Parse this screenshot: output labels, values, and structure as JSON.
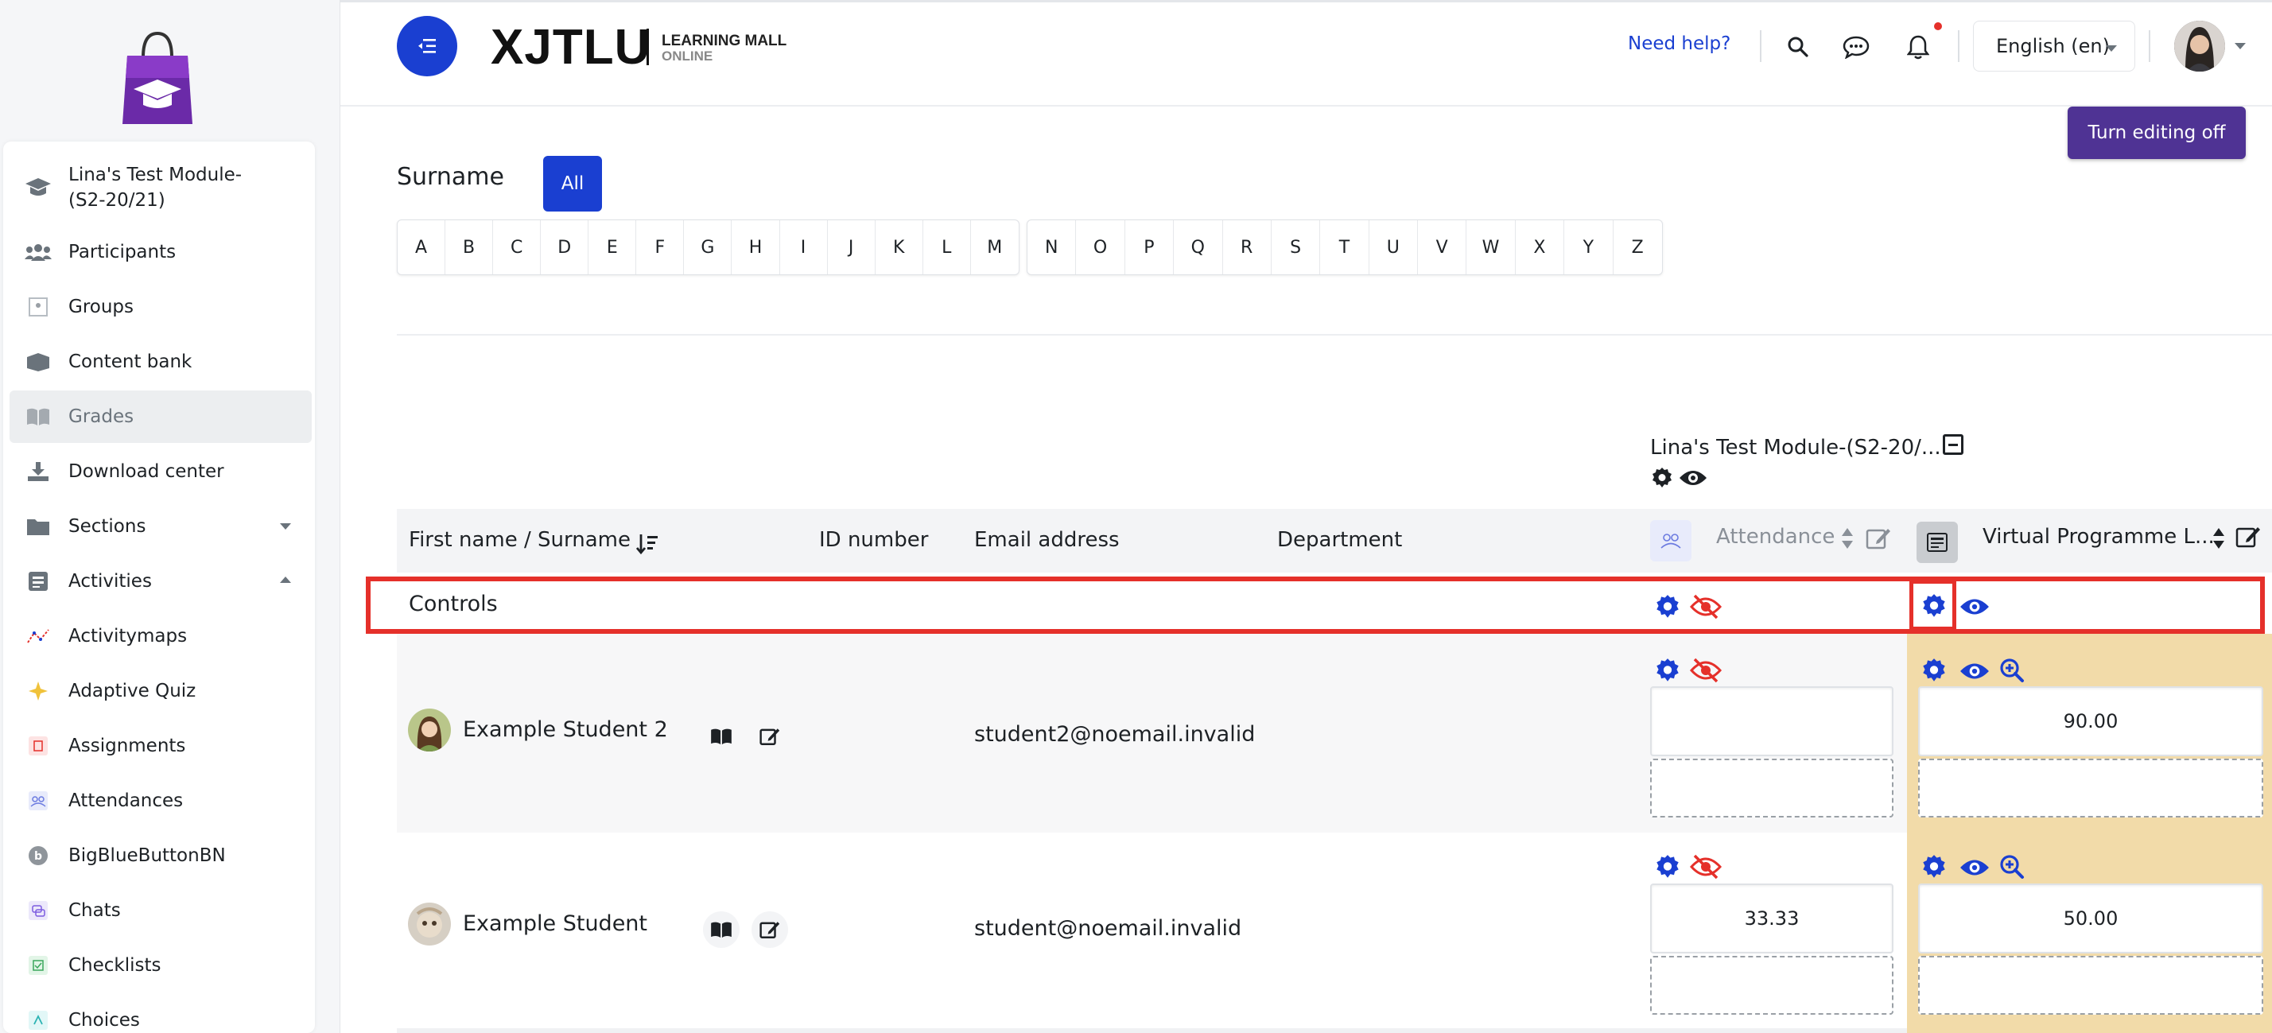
{
  "header": {
    "brand": "XJTLU",
    "brand_sub1": "LEARNING MALL",
    "brand_sub2": "ONLINE",
    "help_link": "Need help?",
    "language": "English (en)",
    "edit_button": "Turn editing off"
  },
  "sidebar": {
    "items": [
      {
        "label": "Lina's Test Module-(S2-20/21)",
        "icon": "graduation-cap-icon"
      },
      {
        "label": "Participants",
        "icon": "users-icon"
      },
      {
        "label": "Groups",
        "icon": "groups-icon"
      },
      {
        "label": "Content bank",
        "icon": "boxes-icon"
      },
      {
        "label": "Grades",
        "icon": "book-icon"
      },
      {
        "label": "Download center",
        "icon": "download-icon"
      },
      {
        "label": "Sections",
        "icon": "folder-icon"
      },
      {
        "label": "Activities",
        "icon": "activities-icon"
      },
      {
        "label": "Activitymaps",
        "icon": "activitymap-icon"
      },
      {
        "label": "Adaptive Quiz",
        "icon": "adaptive-quiz-icon"
      },
      {
        "label": "Assignments",
        "icon": "assignment-icon"
      },
      {
        "label": "Attendances",
        "icon": "attendance-icon"
      },
      {
        "label": "BigBlueButtonBN",
        "icon": "bigbluebutton-icon"
      },
      {
        "label": "Chats",
        "icon": "chat-icon"
      },
      {
        "label": "Checklists",
        "icon": "checklist-icon"
      },
      {
        "label": "Choices",
        "icon": "choice-icon"
      }
    ]
  },
  "filter": {
    "surname_label": "Surname",
    "all_label": "All",
    "letters_a": [
      "A",
      "B",
      "C",
      "D",
      "E",
      "F",
      "G",
      "H",
      "I",
      "J",
      "K",
      "L",
      "M"
    ],
    "letters_n": [
      "N",
      "O",
      "P",
      "Q",
      "R",
      "S",
      "T",
      "U",
      "V",
      "W",
      "X",
      "Y",
      "Z"
    ]
  },
  "grader": {
    "category_title": "Lina's Test Module-(S2-20/...",
    "columns": {
      "name": "First name / Surname",
      "id": "ID number",
      "email": "Email address",
      "department": "Department",
      "attendance": "Attendance",
      "virtual": "Virtual Programme L..."
    },
    "controls_label": "Controls",
    "rows": [
      {
        "name": "Example Student 2",
        "email": "student2@noemail.invalid",
        "attendance": "",
        "virtual": "90.00"
      },
      {
        "name": "Example Student",
        "email": "student@noemail.invalid",
        "attendance": "33.33",
        "virtual": "50.00"
      }
    ]
  },
  "colors": {
    "accent": "#1a3fd1",
    "edit_button": "#4f3394",
    "highlight": "#e5302a",
    "column_tint": "#f2dba9"
  }
}
